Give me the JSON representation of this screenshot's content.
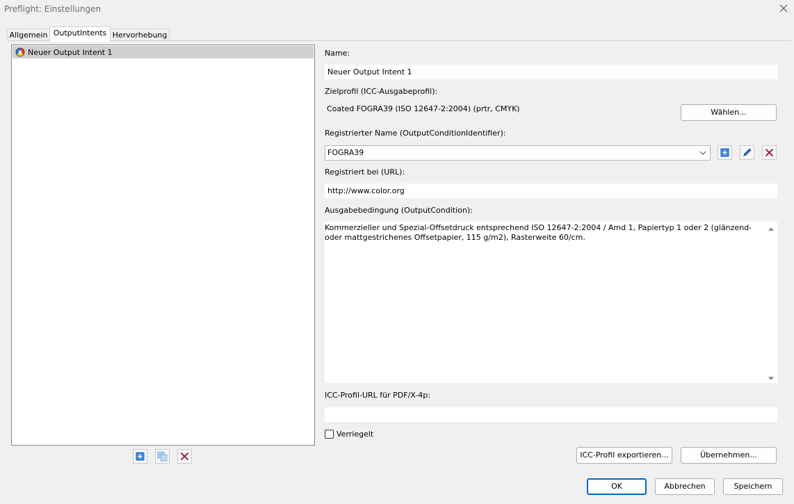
{
  "window": {
    "title": "Preflight: Einstellungen"
  },
  "tabs": [
    {
      "label": "Allgemein"
    },
    {
      "label": "OutputIntents"
    },
    {
      "label": "Hervorhebung"
    }
  ],
  "list": {
    "items": [
      {
        "label": "Neuer Output Intent 1"
      }
    ]
  },
  "form": {
    "name_label": "Name:",
    "name_value": "Neuer Output Intent 1",
    "profile_label": "Zielprofil (ICC-Ausgabeprofil):",
    "profile_value": "Coated FOGRA39 (ISO 12647-2:2004) (prtr, CMYK)",
    "choose_button": "Wählen...",
    "registered_name_label": "Registrierter Name (OutputConditionIdentifier):",
    "registered_name_value": "FOGRA39",
    "registry_label": "Registriert bei (URL):",
    "registry_value": "http://www.color.org",
    "condition_label": "Ausgabebedingung (OutputCondition):",
    "condition_value": "Kommerzieller und Spezial-Offsetdruck entsprechend ISO 12647-2:2004 / Amd 1, Papiertyp 1 oder 2 (glänzend- oder mattgestrichenes Offsetpapier, 115 g/m2), Rasterweite 60/cm.",
    "icc_url_label": "ICC-Profil-URL für PDF/X-4p:",
    "icc_url_value": "",
    "locked_label": "Verriegelt",
    "locked_checked": false,
    "export_button": "ICC-Profil exportieren...",
    "apply_button": "Übernehmen..."
  },
  "footer": {
    "ok": "OK",
    "cancel": "Abbrechen",
    "save": "Speichern"
  },
  "colors": {
    "accent": "#0067c0",
    "delete": "#a0205a",
    "add": "#1f6fd0"
  }
}
